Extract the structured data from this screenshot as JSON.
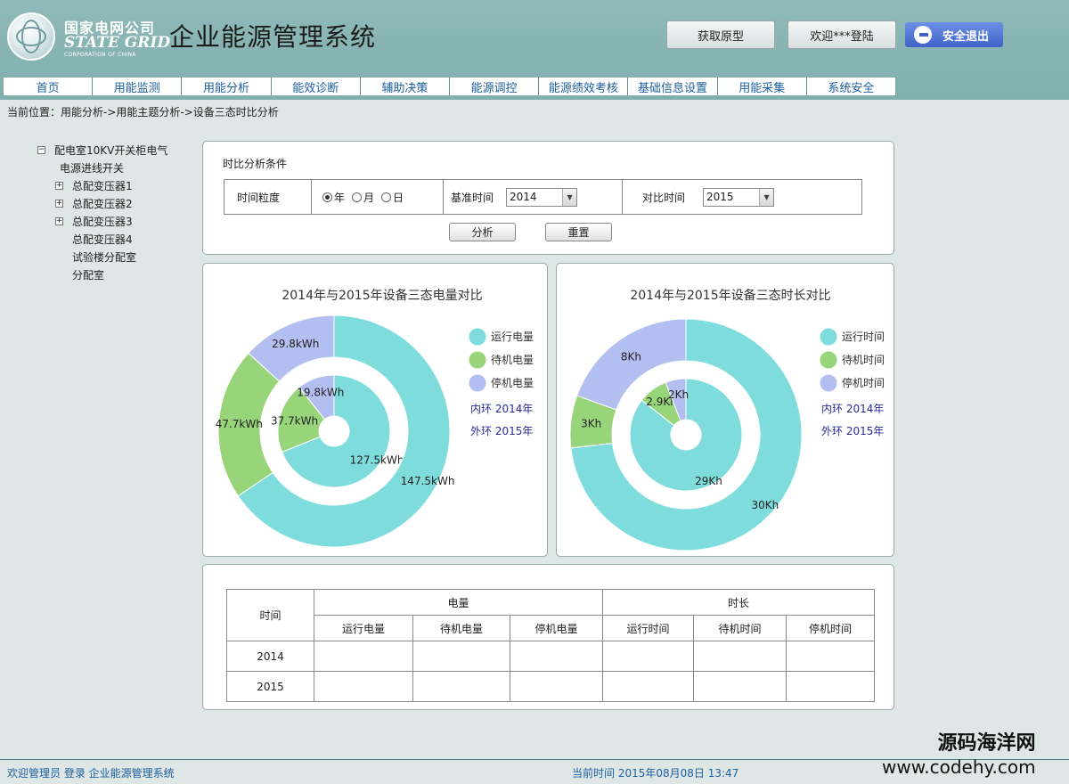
{
  "header": {
    "logo_cn": "国家电网公司",
    "logo_en": "STATE GRID",
    "logo_en2": "CORPORATION OF CHINA",
    "system_title": "企业能源管理系统",
    "btn_prototype": "获取原型",
    "btn_welcome": "欢迎***登陆",
    "btn_logout": "安全退出"
  },
  "nav": [
    "首页",
    "用能监测",
    "用能分析",
    "能效诊断",
    "辅助决策",
    "能源调控",
    "能源绩效考核",
    "基础信息设置",
    "用能采集",
    "系统安全"
  ],
  "breadcrumb": "当前位置：用能分析->用能主题分析->设备三态时比分析",
  "tree": {
    "root": "配电室10KV开关柜电气",
    "items": [
      {
        "label": "电源进线开关",
        "expandable": false
      },
      {
        "label": "总配变压器1",
        "expandable": true
      },
      {
        "label": "总配变压器2",
        "expandable": true
      },
      {
        "label": "总配变压器3",
        "expandable": true
      },
      {
        "label": "总配变压器4",
        "expandable": false
      },
      {
        "label": "试验楼分配室",
        "expandable": false
      },
      {
        "label": "分配室",
        "expandable": false
      }
    ]
  },
  "conditions": {
    "title": "时比分析条件",
    "granularity_label": "时间粒度",
    "opt_year": "年",
    "opt_month": "月",
    "opt_day": "日",
    "base_label": "基准时间",
    "base_value": "2014",
    "compare_label": "对比时间",
    "compare_value": "2015",
    "btn_analyze": "分析",
    "btn_reset": "重置"
  },
  "chart_data": [
    {
      "type": "pie",
      "title": "2014年与2015年设备三态电量对比",
      "legend": [
        "运行电量",
        "待机电量",
        "停机电量"
      ],
      "ring_notes": [
        "内环 2014年",
        "外环 2015年"
      ],
      "series": [
        {
          "name": "内环 2014年",
          "values": [
            127.5,
            37.7,
            19.8
          ],
          "labels": [
            "127.5kWh",
            "37.7kWh",
            "19.8kWh"
          ]
        },
        {
          "name": "外环 2015年",
          "values": [
            147.5,
            47.7,
            29.8
          ],
          "labels": [
            "147.5kWh",
            "47.7kWh",
            "29.8kWh"
          ]
        }
      ]
    },
    {
      "type": "pie",
      "title": "2014年与2015年设备三态时长对比",
      "legend": [
        "运行时间",
        "待机时间",
        "停机时间"
      ],
      "ring_notes": [
        "内环 2014年",
        "外环 2015年"
      ],
      "series": [
        {
          "name": "内环 2014年",
          "values": [
            29,
            2.9,
            2
          ],
          "labels": [
            "29Kh",
            "2.9Kh",
            "2Kh"
          ]
        },
        {
          "name": "外环 2015年",
          "values": [
            30,
            3,
            8
          ],
          "labels": [
            "30Kh",
            "3Kh",
            "8Kh"
          ]
        }
      ]
    }
  ],
  "colors": {
    "run": "#7fdcdc",
    "standby": "#98d47a",
    "stop": "#b3bff0",
    "ring_note": "#2a2aa0"
  },
  "table": {
    "time_header": "时间",
    "group_power": "电量",
    "group_duration": "时长",
    "cols": [
      "运行电量",
      "待机电量",
      "停机电量",
      "运行时间",
      "待机时间",
      "停机时间"
    ],
    "rows": [
      "2014",
      "2015"
    ]
  },
  "footer": {
    "left": "欢迎管理员 登录 企业能源管理系统",
    "time": "当前时间 2015年08月08日 13:47"
  },
  "watermark": {
    "line1": "源码海洋网",
    "line2": "www.codehy.com"
  }
}
